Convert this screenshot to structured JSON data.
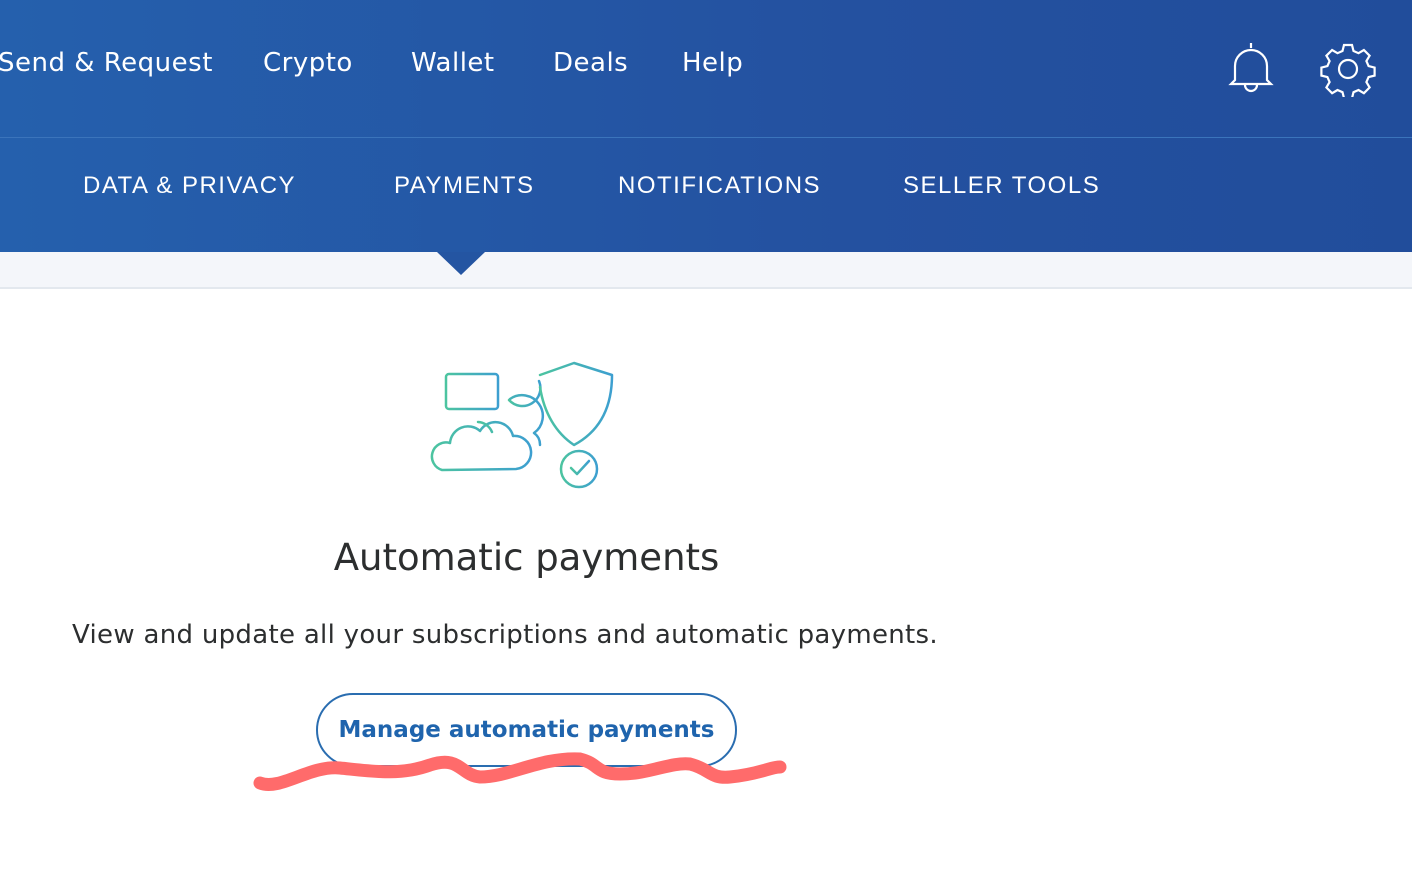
{
  "topnav": {
    "items": [
      "Send & Request",
      "Crypto",
      "Wallet",
      "Deals",
      "Help"
    ]
  },
  "tabs": [
    {
      "label": "DATA & PRIVACY"
    },
    {
      "label": "PAYMENTS",
      "active": true
    },
    {
      "label": "NOTIFICATIONS"
    },
    {
      "label": "SELLER TOOLS"
    }
  ],
  "icons": {
    "notifications": "bell-icon",
    "settings": "gear-icon",
    "illustration": "card-cloud-shield-illustration"
  },
  "main": {
    "title": "Automatic payments",
    "description": "View and update all your subscriptions and automatic payments.",
    "button": "Manage automatic payments"
  },
  "colors": {
    "header": "#2458a5",
    "button_text": "#1f64ad",
    "annotation": "#ff6b6b"
  }
}
